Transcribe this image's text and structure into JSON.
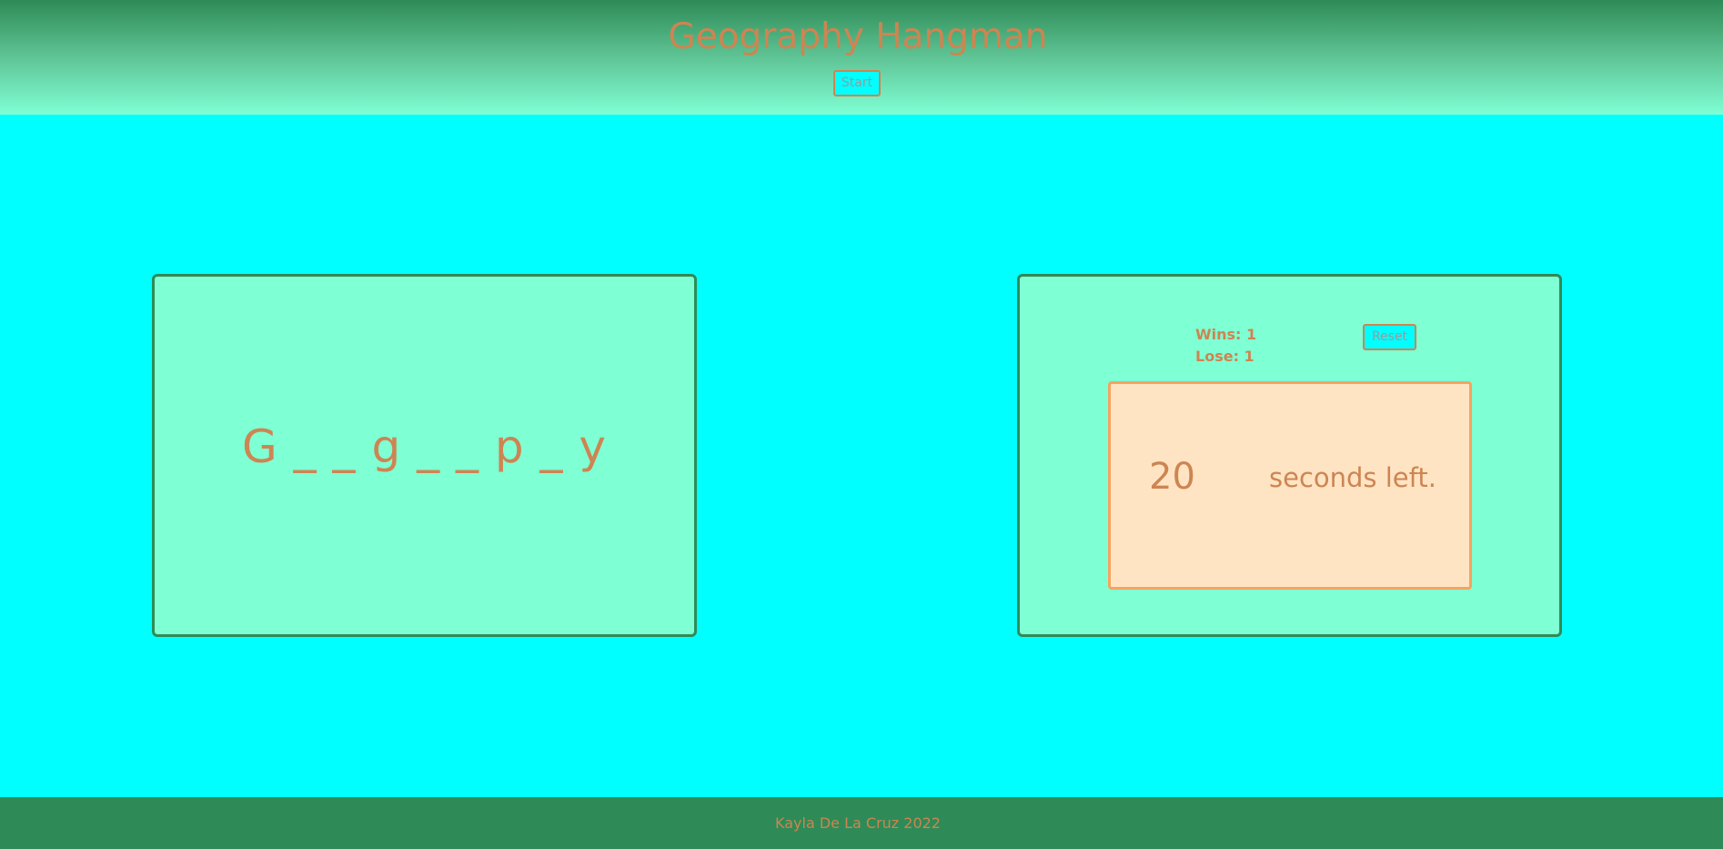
{
  "header": {
    "title": "Geography Hangman",
    "start_label": "Start"
  },
  "game": {
    "word_display": "G _ _ g _ _ p _ y"
  },
  "scoreboard": {
    "wins_label": "Wins: 1",
    "lose_label": "Lose: 1",
    "reset_label": "Reset"
  },
  "timer": {
    "seconds": "20",
    "label": "seconds left."
  },
  "footer": {
    "credit": "Kayla De La Cruz 2022"
  },
  "colors": {
    "page_background": "#00ffff",
    "header_gradient_top": "#2e8b57",
    "header_gradient_bottom": "#7fffd4",
    "panel_background": "#7fffd4",
    "panel_border": "#2e8b57",
    "text": "#cd8552",
    "timer_background": "#ffe4c4",
    "timer_border": "#f4a460",
    "footer_background": "#2e8b57"
  }
}
